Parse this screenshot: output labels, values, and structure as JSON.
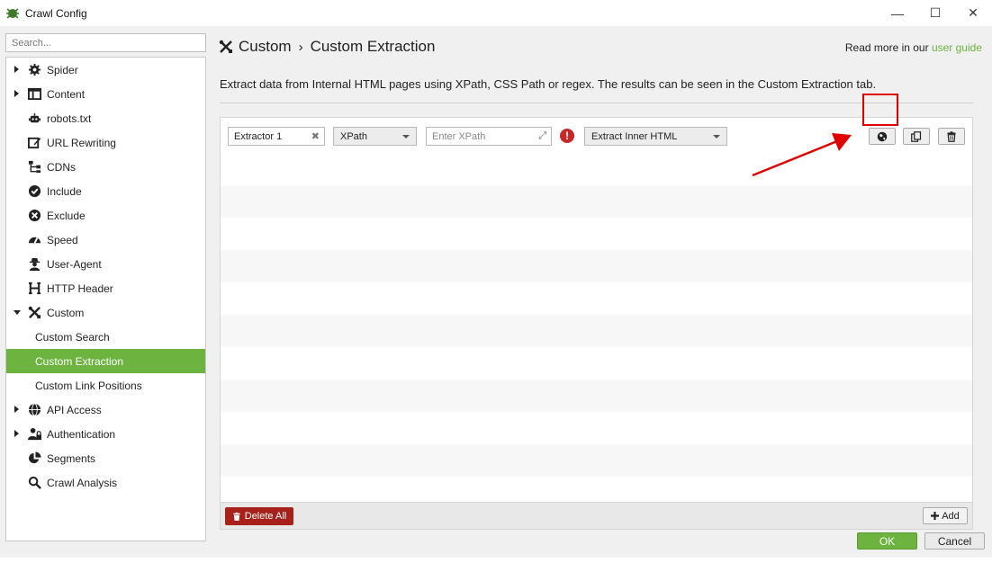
{
  "window": {
    "title": "Crawl Config",
    "minimize": "—",
    "maximize": "☐",
    "close": "✕"
  },
  "sidebar": {
    "search_placeholder": "Search...",
    "items": [
      {
        "label": "Spider",
        "icon": "gear-icon",
        "arrow": "right"
      },
      {
        "label": "Content",
        "icon": "content-icon",
        "arrow": "right"
      },
      {
        "label": "robots.txt",
        "icon": "robot-icon"
      },
      {
        "label": "URL Rewriting",
        "icon": "edit-icon"
      },
      {
        "label": "CDNs",
        "icon": "sitemap-icon"
      },
      {
        "label": "Include",
        "icon": "check-circle-icon"
      },
      {
        "label": "Exclude",
        "icon": "x-circle-icon"
      },
      {
        "label": "Speed",
        "icon": "gauge-icon"
      },
      {
        "label": "User-Agent",
        "icon": "user-secret-icon"
      },
      {
        "label": "HTTP Header",
        "icon": "header-icon"
      },
      {
        "label": "Custom",
        "icon": "tools-icon",
        "arrow": "down"
      },
      {
        "label": "Custom Search",
        "sub": true
      },
      {
        "label": "Custom Extraction",
        "sub": true,
        "selected": true
      },
      {
        "label": "Custom Link Positions",
        "sub": true
      },
      {
        "label": "API Access",
        "icon": "globe-icon",
        "arrow": "right"
      },
      {
        "label": "Authentication",
        "icon": "user-lock-icon",
        "arrow": "right"
      },
      {
        "label": "Segments",
        "icon": "pie-chart-icon"
      },
      {
        "label": "Crawl Analysis",
        "icon": "search-icon"
      }
    ]
  },
  "header": {
    "crumb_parent": "Custom",
    "crumb_separator": "›",
    "crumb_current": "Custom Extraction",
    "read_more": "Read more in our",
    "user_guide": "user guide"
  },
  "description": "Extract data from Internal HTML pages using XPath, CSS Path or regex. The results can be seen in the Custom Extraction tab.",
  "extractor": {
    "name": "Extractor 1",
    "type": "XPath",
    "query_placeholder": "Enter XPath",
    "error_symbol": "!",
    "extract_mode": "Extract Inner HTML"
  },
  "buttons": {
    "delete_all": "Delete All",
    "add": "Add",
    "ok": "OK",
    "cancel": "Cancel"
  },
  "colors": {
    "accent": "#6db33f",
    "danger": "#a8201a",
    "highlight": "#e00000"
  }
}
